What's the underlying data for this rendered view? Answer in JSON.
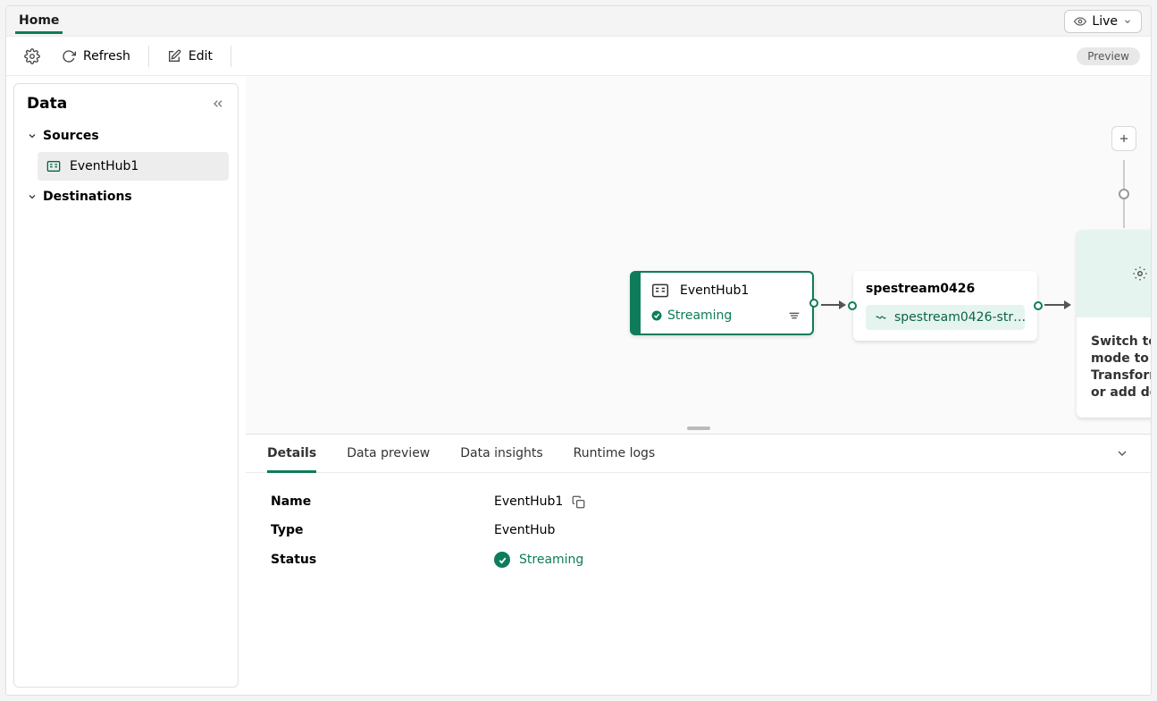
{
  "tabrow": {
    "home": "Home",
    "live": "Live"
  },
  "toolbar": {
    "refresh": "Refresh",
    "edit": "Edit",
    "preview_badge": "Preview"
  },
  "sidebar": {
    "title": "Data",
    "sources_label": "Sources",
    "destinations_label": "Destinations",
    "items": [
      {
        "label": "EventHub1"
      }
    ]
  },
  "canvas": {
    "source_node": {
      "name": "EventHub1",
      "status": "Streaming"
    },
    "stream_node": {
      "title": "spestream0426",
      "chip": "spestream0426-str…"
    },
    "placeholder_node": {
      "text": "Switch to edit mode to Transform event or add destination"
    }
  },
  "panel": {
    "tabs": [
      "Details",
      "Data preview",
      "Data insights",
      "Runtime logs"
    ],
    "details": {
      "name_label": "Name",
      "name_value": "EventHub1",
      "type_label": "Type",
      "type_value": "EventHub",
      "status_label": "Status",
      "status_value": "Streaming"
    }
  }
}
